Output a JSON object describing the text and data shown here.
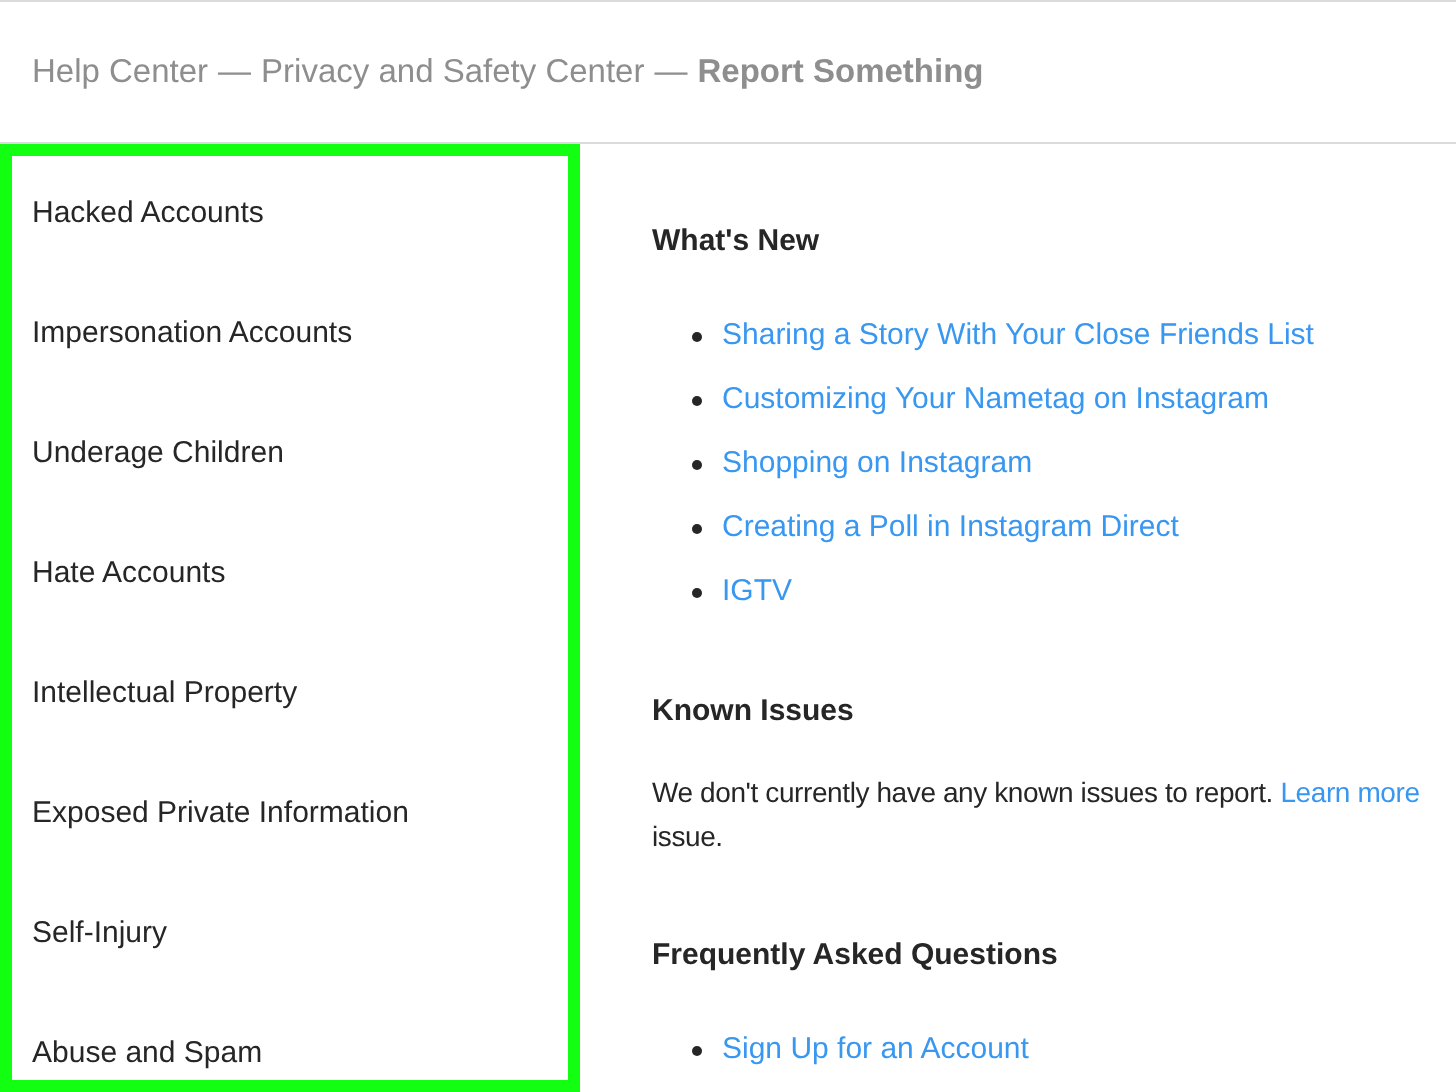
{
  "breadcrumb": {
    "separator": "—",
    "items": [
      {
        "label": "Help Center",
        "current": false
      },
      {
        "label": "Privacy and Safety Center",
        "current": false
      },
      {
        "label": "Report Something",
        "current": true
      }
    ]
  },
  "sidebar": {
    "highlighted": true,
    "items": [
      "Hacked Accounts",
      "Impersonation Accounts",
      "Underage Children",
      "Hate Accounts",
      "Intellectual Property",
      "Exposed Private Information",
      "Self-Injury",
      "Abuse and Spam"
    ]
  },
  "sections": [
    {
      "title": "What's New",
      "kind": "links",
      "links": [
        "Sharing a Story With Your Close Friends List",
        "Customizing Your Nametag on Instagram",
        "Shopping on Instagram",
        "Creating a Poll in Instagram Direct",
        "IGTV"
      ]
    },
    {
      "title": "Known Issues",
      "kind": "text",
      "text": "We don't currently have any known issues to report.",
      "link": "Learn more",
      "text_after": "issue."
    },
    {
      "title": "Frequently Asked Questions",
      "kind": "links",
      "links": [
        "Sign Up for an Account"
      ]
    }
  ]
}
